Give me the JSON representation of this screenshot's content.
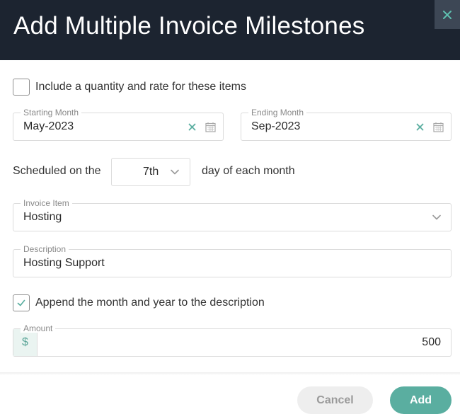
{
  "dialog": {
    "title": "Add Multiple Invoice Milestones",
    "close_glyph": "×"
  },
  "include_quantity": {
    "label": "Include a quantity and rate for these items",
    "checked": false
  },
  "starting_month": {
    "label": "Starting Month",
    "value": "May-2023"
  },
  "ending_month": {
    "label": "Ending Month",
    "value": "Sep-2023"
  },
  "schedule": {
    "prefix": "Scheduled on the",
    "day_value": "7th",
    "suffix": "day of each month"
  },
  "invoice_item": {
    "label": "Invoice Item",
    "value": "Hosting"
  },
  "description": {
    "label": "Description",
    "value": "Hosting Support"
  },
  "append_month_year": {
    "label": "Append the month and year to the description",
    "checked": true
  },
  "amount": {
    "label": "Amount",
    "currency_symbol": "$",
    "value": "500"
  },
  "footer": {
    "cancel_label": "Cancel",
    "add_label": "Add"
  },
  "colors": {
    "header_bg": "#1c2430",
    "accent": "#5aaea0",
    "clear_icon": "#5aaea0"
  }
}
